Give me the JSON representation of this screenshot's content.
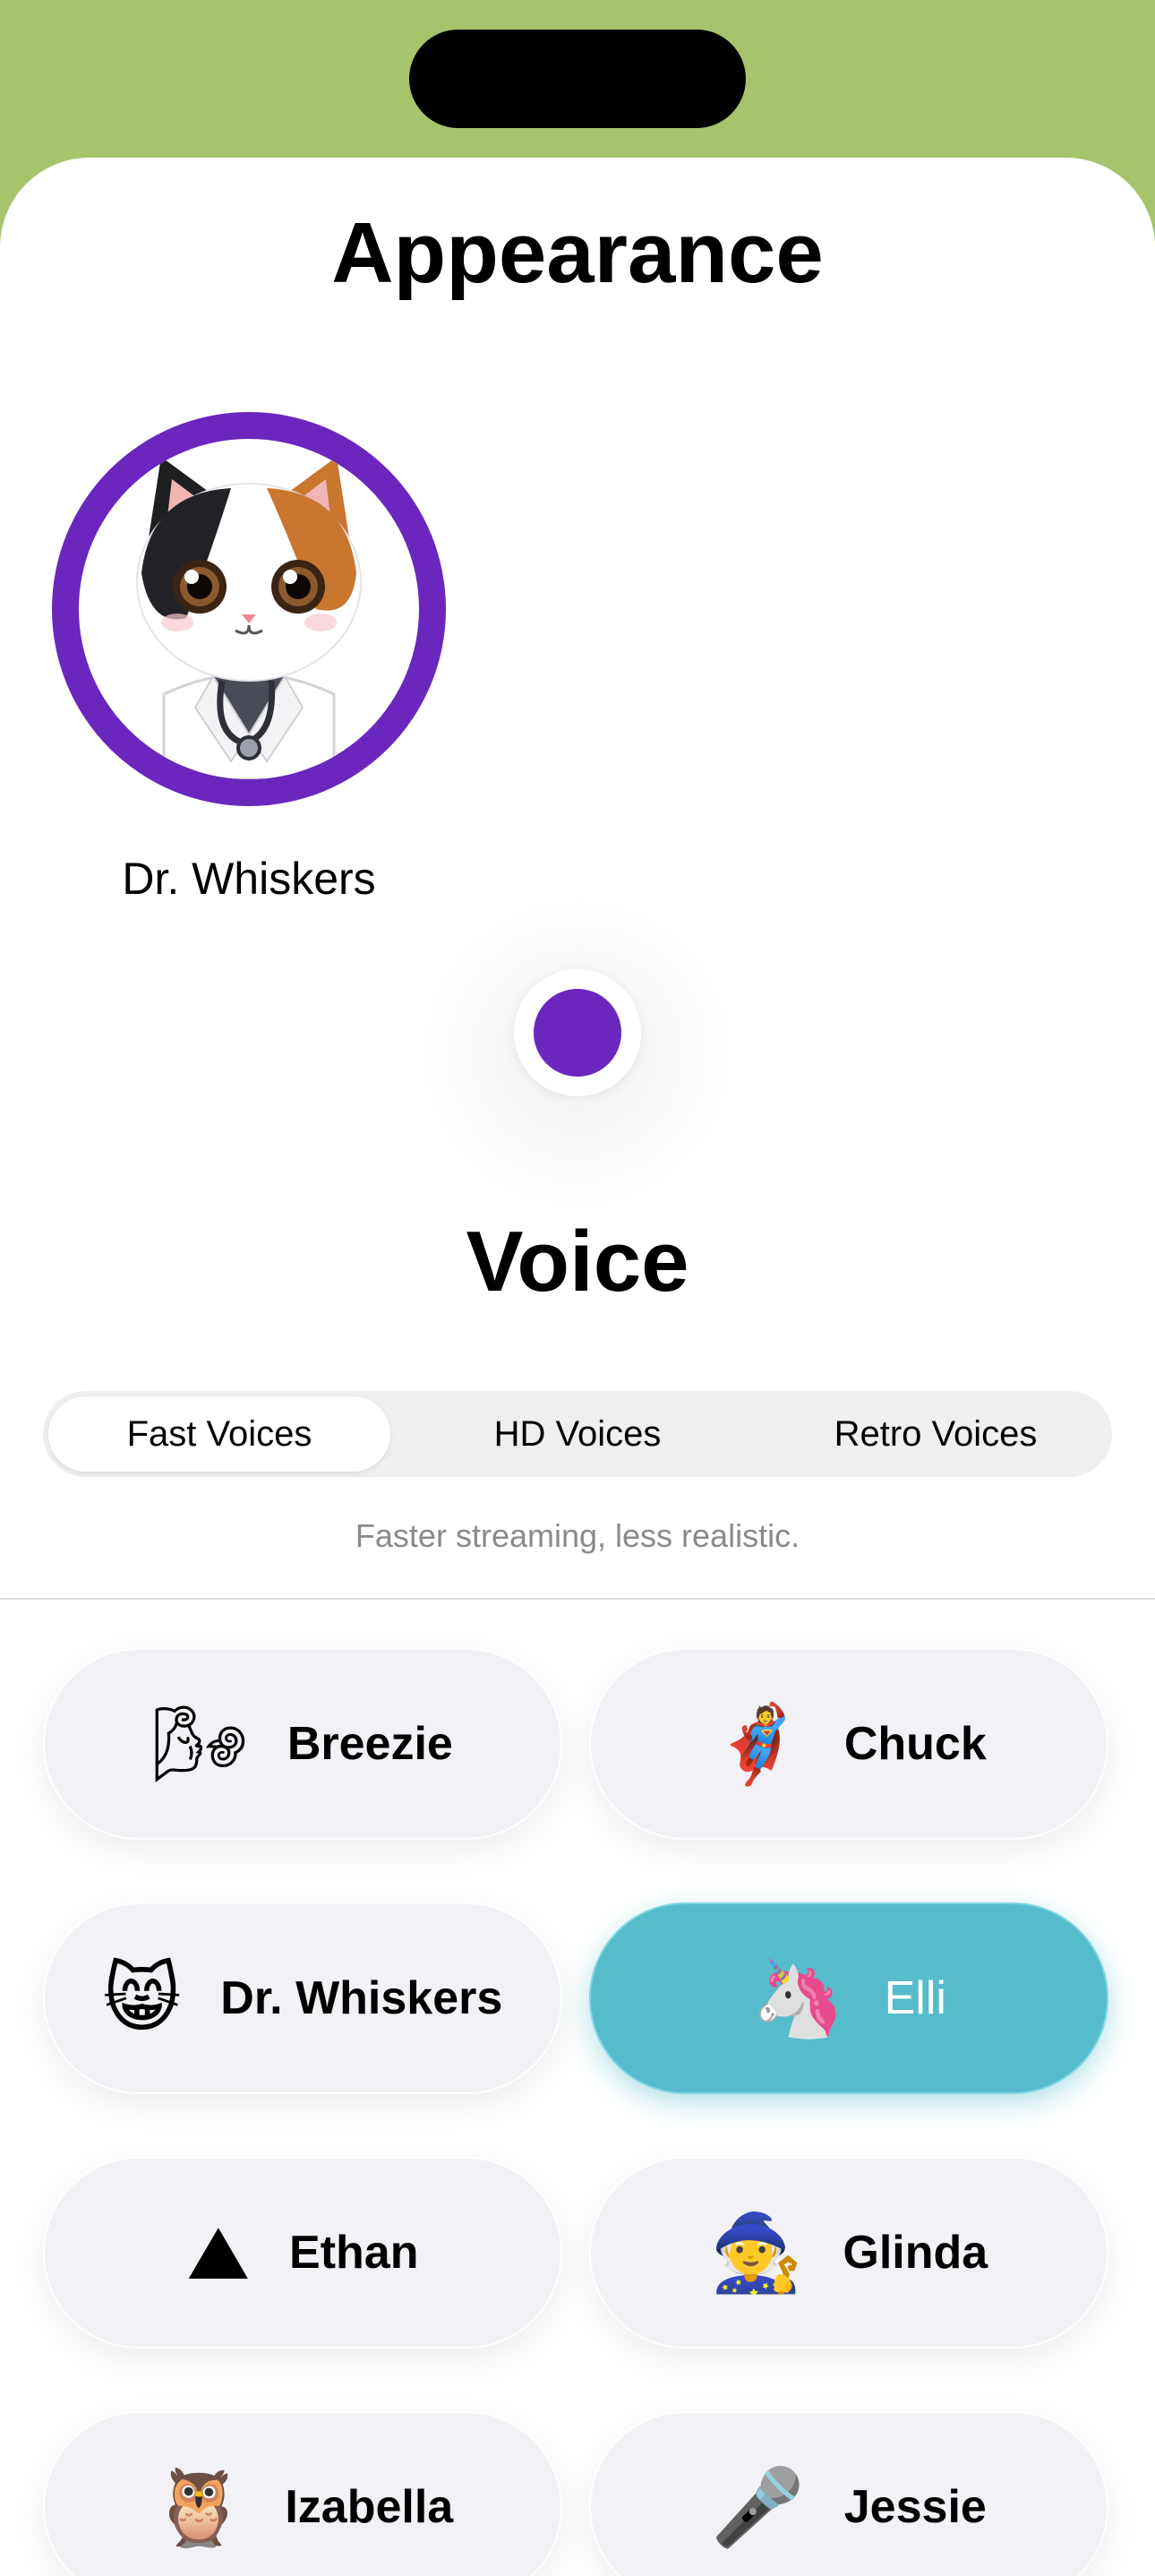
{
  "appearance": {
    "title": "Appearance",
    "character_name": "Dr. Whiskers",
    "accent_color": "#6a26bd"
  },
  "voice": {
    "title": "Voice",
    "tabs": [
      {
        "label": "Fast Voices",
        "selected": true
      },
      {
        "label": "HD Voices",
        "selected": false
      },
      {
        "label": "Retro Voices",
        "selected": false
      }
    ],
    "caption": "Faster streaming, less realistic.",
    "selected_color": "#56bccc",
    "voices": [
      {
        "name": "Breezie",
        "icon": "wind-face-icon",
        "glyph": "🌬",
        "selected": false
      },
      {
        "name": "Chuck",
        "icon": "superhero-icon",
        "glyph": "🦸",
        "selected": false
      },
      {
        "name": "Dr. Whiskers",
        "icon": "cat-face-icon",
        "glyph": "😸",
        "selected": false
      },
      {
        "name": "Elli",
        "icon": "unicorn-icon",
        "glyph": "🦄",
        "selected": true
      },
      {
        "name": "Ethan",
        "icon": "mountain-icon",
        "glyph": "⛰",
        "selected": false
      },
      {
        "name": "Glinda",
        "icon": "mage-icon",
        "glyph": "🧙",
        "selected": false
      },
      {
        "name": "Izabella",
        "icon": "owl-icon",
        "glyph": "🦉",
        "selected": false
      },
      {
        "name": "Jessie",
        "icon": "microphone-icon",
        "glyph": "🎤",
        "selected": false
      }
    ]
  },
  "background_color": "#a7c46c"
}
